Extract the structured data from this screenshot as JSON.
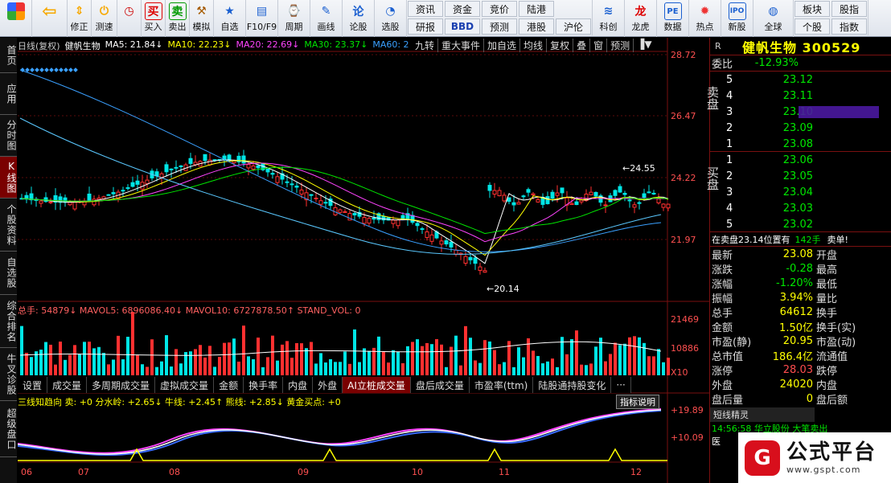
{
  "toolbar": {
    "buttons": [
      "",
      "",
      "修正",
      "测速",
      "买入",
      "卖出",
      "模拟",
      "自选",
      "F10/F9",
      "周期",
      "画线",
      "论股",
      "选股"
    ],
    "grid_top": [
      "资讯",
      "资金",
      "竞价",
      "陆港",
      "沪伦"
    ],
    "grid_bot": [
      "研报",
      "BBD",
      "预测",
      "港股",
      "沪伦"
    ],
    "buttons2": [
      "科创",
      "龙虎",
      "数据",
      "热点",
      "新股",
      "全球"
    ],
    "right_top": [
      "板块",
      "股指"
    ],
    "right_bot": [
      "个股",
      "指数"
    ]
  },
  "sidebar": [
    "首页",
    "应用",
    "分时图",
    "K线图",
    "个股资料",
    "自选股",
    "综合排名",
    "牛叉诊股",
    "超级盘口"
  ],
  "kline": {
    "header": "日线(复权)",
    "name": "健帆生物",
    "ma5": "MA5: 21.84↓",
    "ma10": "MA10: 22.23↓",
    "ma20": "MA20: 22.69↓",
    "ma30": "MA30: 23.37↓",
    "ma60": "MA60: 2",
    "tools": [
      "九转",
      "重大事件",
      "加自选",
      "均线",
      "复权",
      "叠",
      "窗",
      "预测"
    ],
    "yticks": [
      "28.72",
      "26.47",
      "24.22",
      "21.97"
    ],
    "hi_label": "24.55",
    "lo_label": "20.14",
    "vol_header": "总手: 54879↓ MAVOL5: 6896086.40↓ MAVOL10: 6727878.50↑ STAND_VOL: 0",
    "vol_ticks": [
      "21469",
      "10886",
      "X10"
    ],
    "tabs": [
      "设置",
      "成交量",
      "多周期成交量",
      "虚拟成交量",
      "金额",
      "换手率",
      "内盘",
      "外盘",
      "AI立桩成交量",
      "盘后成交量",
      "市盈率(ttm)",
      "陆股通持股变化",
      "···"
    ],
    "ind_header": "三线知趋向 卖: +0 分水岭: +2.65↓ 牛线: +2.45↑ 熊线: +2.85↓ 黄金买点: +0",
    "ind_btn": "指标说明",
    "ind_ticks": [
      "+19.89",
      "+10.09"
    ],
    "months": [
      "06",
      "07",
      "08",
      "09",
      "10",
      "11",
      "12"
    ]
  },
  "quote": {
    "r": "R",
    "title": "健帆生物 300529",
    "weibi_label": "委比",
    "weibi": "-12.93%",
    "sell_label": "卖盘",
    "buy_label": "买盘",
    "asks": [
      [
        "5",
        "23.12"
      ],
      [
        "4",
        "23.11"
      ],
      [
        "3",
        "23.10"
      ],
      [
        "2",
        "23.09"
      ],
      [
        "1",
        "23.08"
      ]
    ],
    "bids": [
      [
        "1",
        "23.06"
      ],
      [
        "2",
        "23.05"
      ],
      [
        "3",
        "23.04"
      ],
      [
        "4",
        "23.03"
      ],
      [
        "5",
        "23.02"
      ]
    ],
    "note": "在卖盘23.14位置有",
    "note2": "142手",
    "note3": "卖单!",
    "stats": [
      [
        "最新",
        "23.08",
        "开盘"
      ],
      [
        "涨跌",
        "-0.28",
        "最高"
      ],
      [
        "涨幅",
        "-1.20%",
        "最低"
      ],
      [
        "振幅",
        "3.94%",
        "量比"
      ],
      [
        "总手",
        "64612",
        "换手"
      ],
      [
        "金额",
        "1.50亿",
        "换手(实)"
      ],
      [
        "市盈(静)",
        "20.95",
        "市盈(动)"
      ],
      [
        "总市值",
        "186.4亿",
        "流通值"
      ],
      [
        "涨停",
        "28.03",
        "跌停"
      ],
      [
        "外盘",
        "24020",
        "内盘"
      ],
      [
        "盘后量",
        "0",
        "盘后额"
      ]
    ],
    "short_title": "短线精灵",
    "short_row": "14:56:58 华立股份 大笔卖出",
    "short_row2": "医"
  },
  "logo": {
    "text": "公式平台",
    "url": "www.gspt.com"
  }
}
